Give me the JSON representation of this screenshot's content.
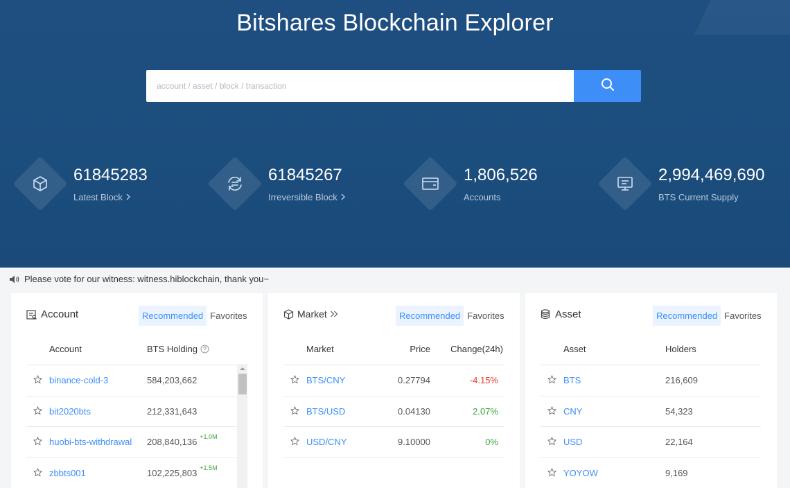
{
  "header": {
    "title": "Bitshares Blockchain Explorer"
  },
  "search": {
    "placeholder": "account / asset / block / transaction"
  },
  "stats": [
    {
      "value": "61845283",
      "label": "Latest Block",
      "icon": "cube-icon"
    },
    {
      "value": "61845267",
      "label": "Irreversible Block",
      "icon": "refresh-icon"
    },
    {
      "value": "1,806,526",
      "label": "Accounts",
      "icon": "wallet-icon"
    },
    {
      "value": "2,994,469,690",
      "label": "BTS Current Supply",
      "icon": "monitor-icon"
    }
  ],
  "notice": {
    "text": "Please vote for our witness: witness.hiblockchain, thank you~"
  },
  "account_card": {
    "title": "Account",
    "tabs": [
      "Recommended",
      "Favorites"
    ],
    "columns": [
      "Account",
      "BTS Holding"
    ],
    "rows": [
      {
        "name": "binance-cold-3",
        "holding": "584,203,662",
        "delta": ""
      },
      {
        "name": "bit2020bts",
        "holding": "212,331,643",
        "delta": ""
      },
      {
        "name": "huobi-bts-withdrawal",
        "holding": "208,840,136",
        "delta": "+1.0M"
      },
      {
        "name": "zbbts001",
        "holding": "102,225,803",
        "delta": "+1.5M"
      }
    ]
  },
  "market_card": {
    "title": "Market",
    "tabs": [
      "Recommended",
      "Favorites"
    ],
    "columns": [
      "Market",
      "Price",
      "Change(24h)"
    ],
    "rows": [
      {
        "pair": "BTS/CNY",
        "price": "0.27794",
        "change": "-4.15%"
      },
      {
        "pair": "BTS/USD",
        "price": "0.04130",
        "change": "2.07%"
      },
      {
        "pair": "USD/CNY",
        "price": "9.10000",
        "change": "0%"
      }
    ]
  },
  "asset_card": {
    "title": "Asset",
    "tabs": [
      "Recommended",
      "Favorites"
    ],
    "columns": [
      "Asset",
      "Holders"
    ],
    "rows": [
      {
        "symbol": "BTS",
        "holders": "216,609"
      },
      {
        "symbol": "CNY",
        "holders": "54,323"
      },
      {
        "symbol": "USD",
        "holders": "22,164"
      },
      {
        "symbol": "YOYOW",
        "holders": "9,169"
      }
    ]
  },
  "colors": {
    "hero_bg": "#1b4d7d",
    "accent": "#3e8ef7",
    "negative": "#e5392f",
    "positive": "#3aa43a"
  }
}
